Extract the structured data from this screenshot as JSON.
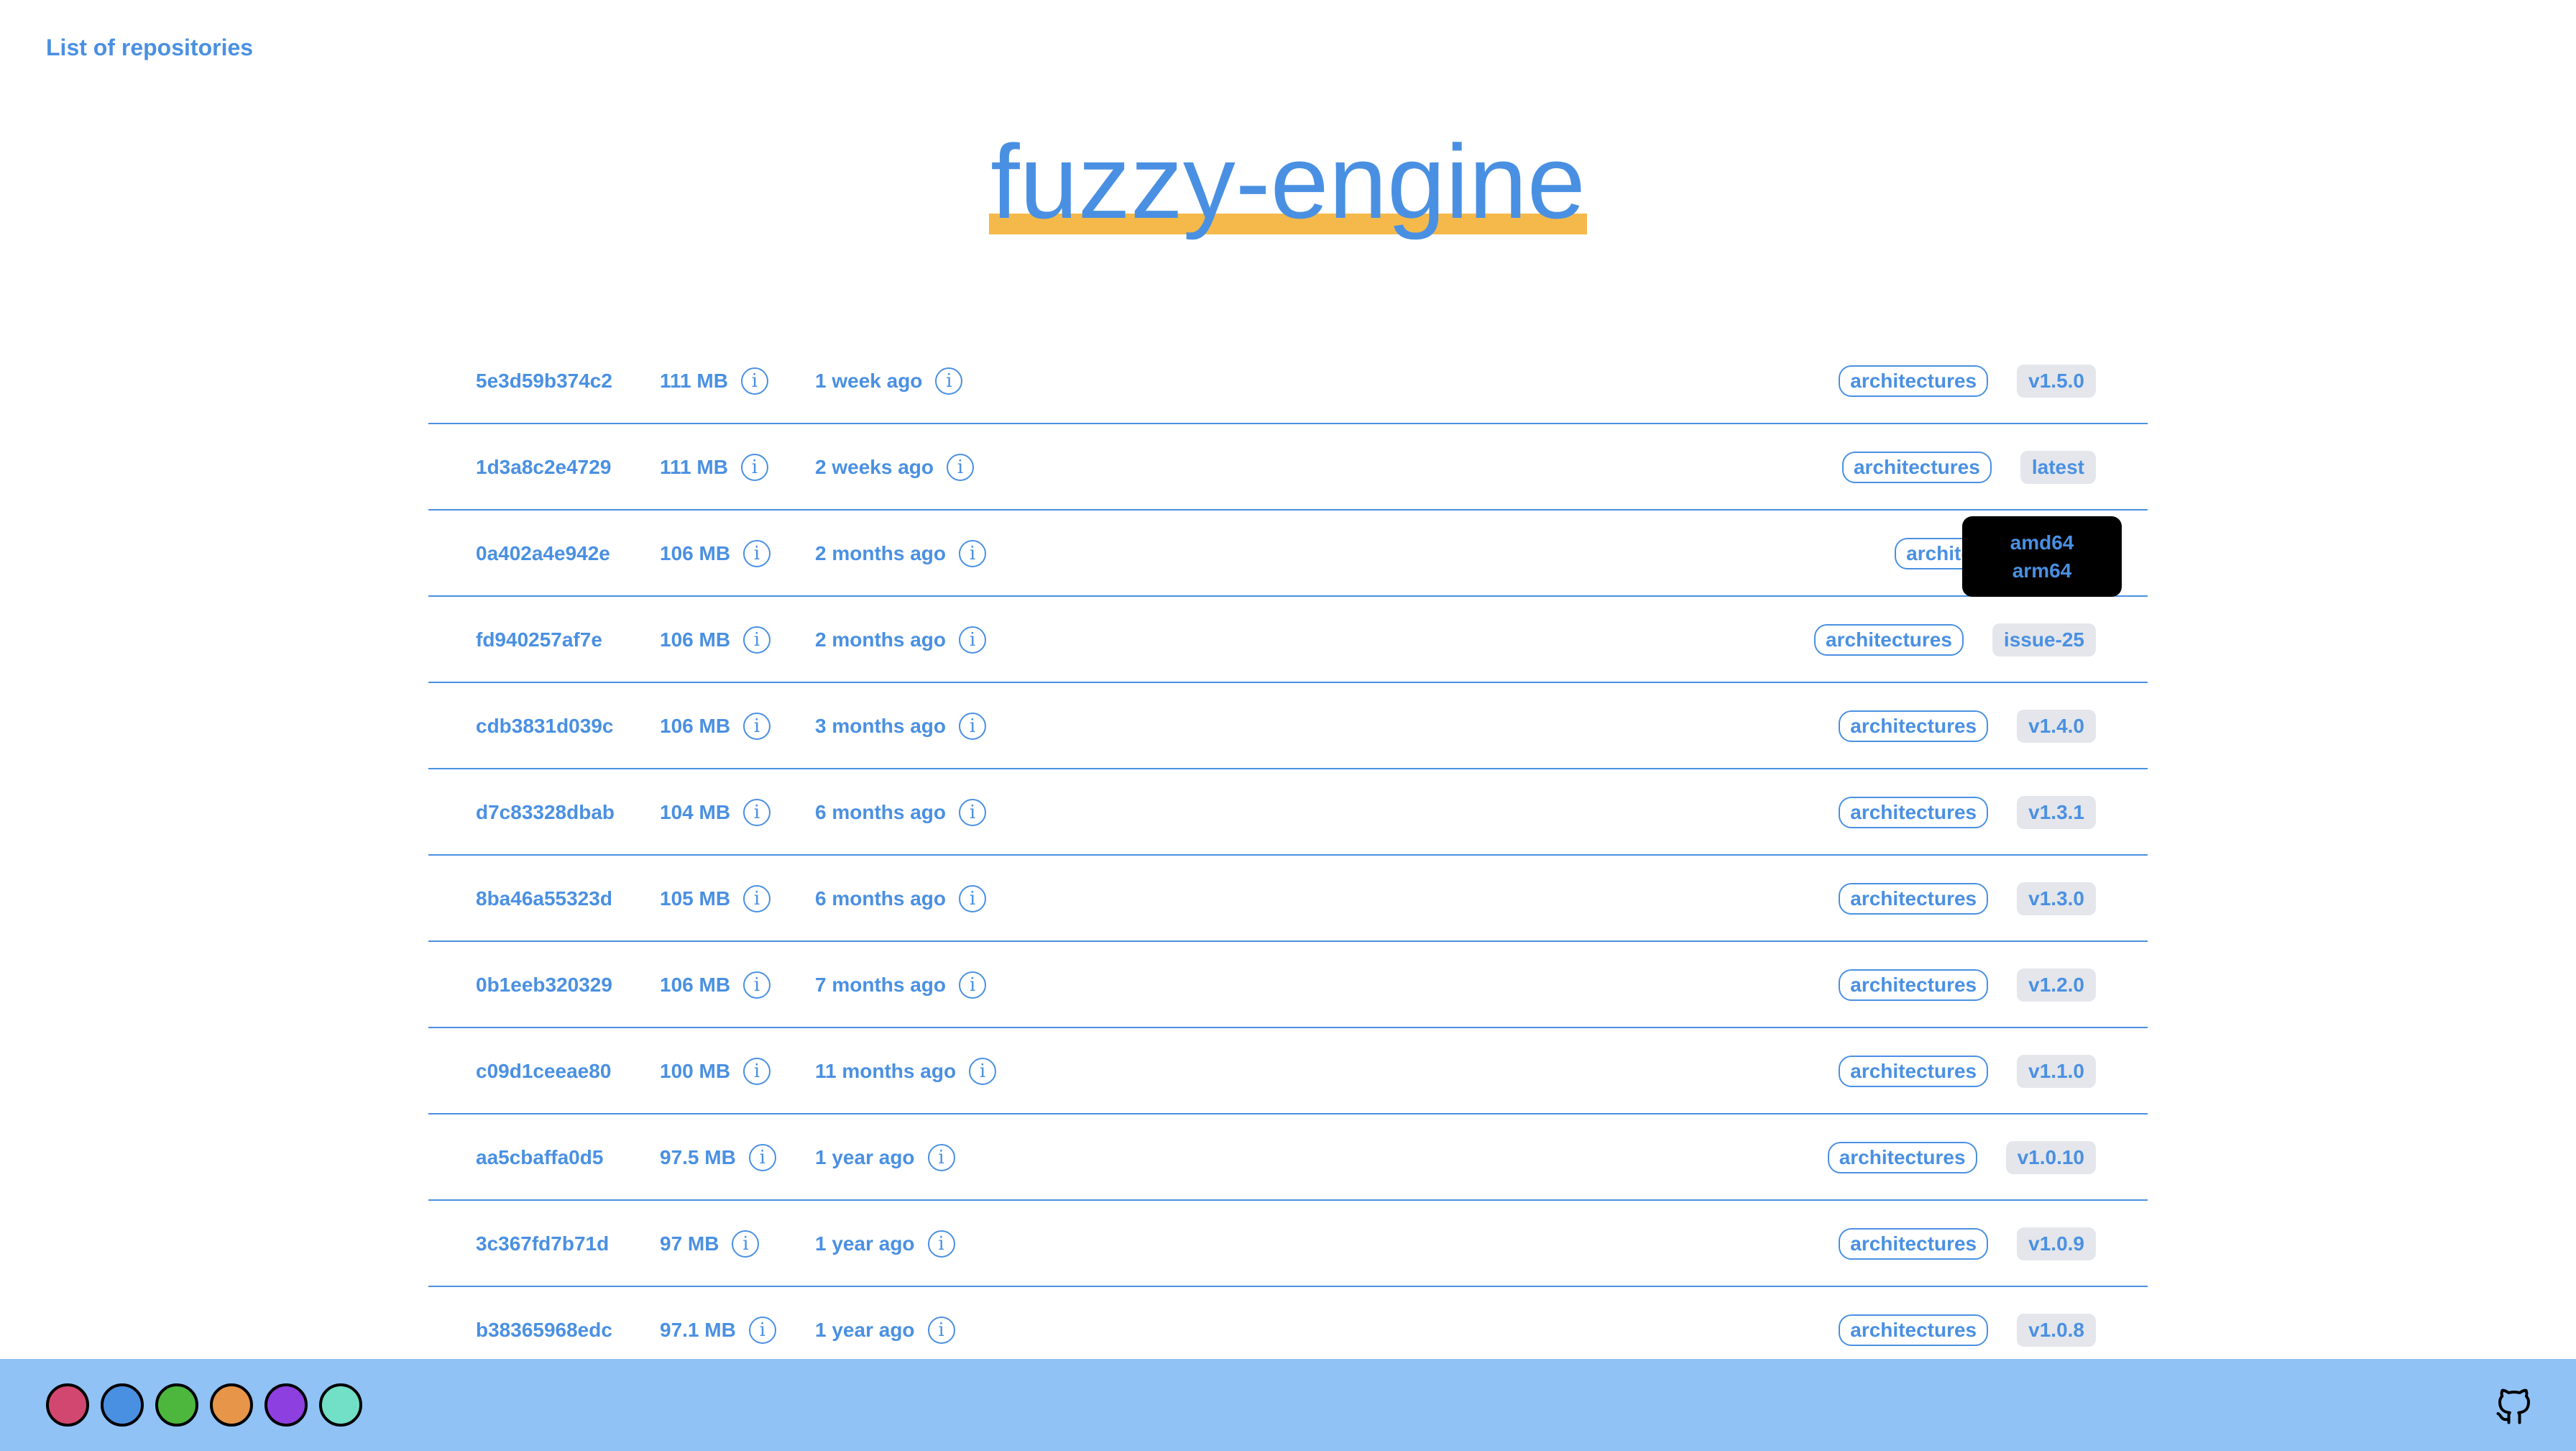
{
  "nav": {
    "back_link": "List of repositories"
  },
  "title": "fuzzy-engine",
  "colors": {
    "accent": "#4a90e2",
    "title_underline": "#f5b94b",
    "tag_background": "#e4e6eb",
    "footer_background": "#90c2f6",
    "tooltip_background": "#000000"
  },
  "rows": [
    {
      "hash": "5e3d59b374c2",
      "size": "111 MB",
      "age": "1 week ago",
      "arch_label": "architectures",
      "tag": "v1.5.0"
    },
    {
      "hash": "1d3a8c2e4729",
      "size": "111 MB",
      "age": "2 weeks ago",
      "arch_label": "architectures",
      "tag": "latest"
    },
    {
      "hash": "0a402a4e942e",
      "size": "106 MB",
      "age": "2 months ago",
      "arch_label": "architectures",
      "tag": ""
    },
    {
      "hash": "fd940257af7e",
      "size": "106 MB",
      "age": "2 months ago",
      "arch_label": "architectures",
      "tag": "issue-25"
    },
    {
      "hash": "cdb3831d039c",
      "size": "106 MB",
      "age": "3 months ago",
      "arch_label": "architectures",
      "tag": "v1.4.0"
    },
    {
      "hash": "d7c83328dbab",
      "size": "104 MB",
      "age": "6 months ago",
      "arch_label": "architectures",
      "tag": "v1.3.1"
    },
    {
      "hash": "8ba46a55323d",
      "size": "105 MB",
      "age": "6 months ago",
      "arch_label": "architectures",
      "tag": "v1.3.0"
    },
    {
      "hash": "0b1eeb320329",
      "size": "106 MB",
      "age": "7 months ago",
      "arch_label": "architectures",
      "tag": "v1.2.0"
    },
    {
      "hash": "c09d1ceeae80",
      "size": "100 MB",
      "age": "11 months ago",
      "arch_label": "architectures",
      "tag": "v1.1.0"
    },
    {
      "hash": "aa5cbaffa0d5",
      "size": "97.5 MB",
      "age": "1 year ago",
      "arch_label": "architectures",
      "tag": "v1.0.10"
    },
    {
      "hash": "3c367fd7b71d",
      "size": "97 MB",
      "age": "1 year ago",
      "arch_label": "architectures",
      "tag": "v1.0.9"
    },
    {
      "hash": "b38365968edc",
      "size": "97.1 MB",
      "age": "1 year ago",
      "arch_label": "architectures",
      "tag": "v1.0.8"
    }
  ],
  "tooltip": {
    "line1": "amd64",
    "line2": "arm64"
  },
  "info_icon_glyph": "i",
  "footer": {
    "theme_swatches": [
      {
        "name": "red",
        "color": "#d2476f"
      },
      {
        "name": "blue",
        "color": "#4a90e2"
      },
      {
        "name": "green",
        "color": "#4db73d"
      },
      {
        "name": "orange",
        "color": "#e79548"
      },
      {
        "name": "purple",
        "color": "#8e3fe0"
      },
      {
        "name": "teal",
        "color": "#72e0c6"
      }
    ],
    "github_icon": "github-icon"
  }
}
